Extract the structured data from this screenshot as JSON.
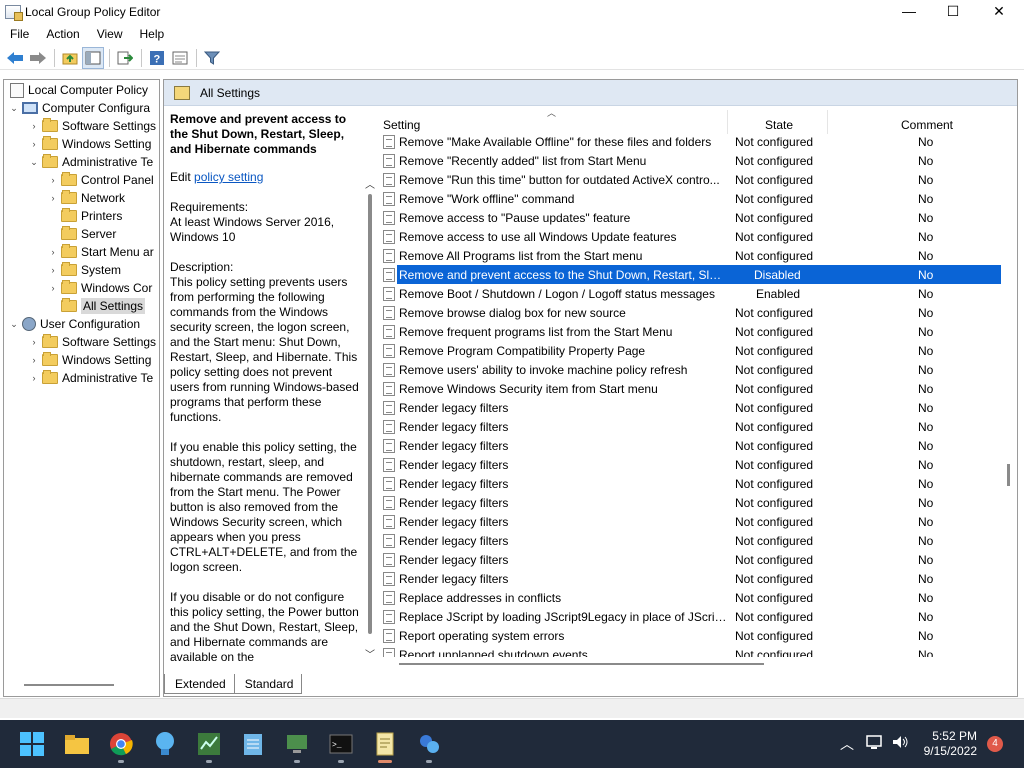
{
  "window": {
    "title": "Local Group Policy Editor",
    "minimize": "—",
    "maximize": "☐",
    "close": "✕"
  },
  "menu": [
    "File",
    "Action",
    "View",
    "Help"
  ],
  "tree": {
    "items": [
      {
        "label": "Local Computer Policy"
      },
      {
        "label": "Computer Configura"
      },
      {
        "label": "Software Settings"
      },
      {
        "label": "Windows Setting"
      },
      {
        "label": "Administrative Te"
      },
      {
        "label": "Control Panel"
      },
      {
        "label": "Network"
      },
      {
        "label": "Printers"
      },
      {
        "label": "Server"
      },
      {
        "label": "Start Menu ar"
      },
      {
        "label": "System"
      },
      {
        "label": "Windows Cor"
      },
      {
        "label": "All Settings"
      },
      {
        "label": "User Configuration"
      },
      {
        "label": "Software Settings"
      },
      {
        "label": "Windows Setting"
      },
      {
        "label": "Administrative Te"
      }
    ]
  },
  "panel": {
    "header": "All Settings"
  },
  "description": {
    "title": "Remove and prevent access to the Shut Down, Restart, Sleep, and Hibernate commands",
    "edit_prefix": "Edit ",
    "edit_link": "policy setting",
    "requirements": "Requirements:\nAt least Windows Server 2016, Windows 10",
    "description": "Description:\nThis policy setting prevents users from performing the following commands from the Windows security screen, the logon screen, and the Start menu: Shut Down, Restart, Sleep, and Hibernate. This policy setting does not prevent users from running Windows-based programs that perform these functions.",
    "enable_text": "If you enable this policy setting, the shutdown, restart, sleep, and hibernate commands are removed from the Start menu. The Power button is also removed from the Windows Security screen, which appears when you press CTRL+ALT+DELETE, and from the logon screen.",
    "disable_text": "If you disable or do not configure this policy setting, the Power button and the Shut Down, Restart, Sleep, and Hibernate commands are available on the"
  },
  "list": {
    "columns": {
      "setting": "Setting",
      "state": "State",
      "comment": "Comment"
    },
    "rows": [
      {
        "name": "Remove \"Make Available Offline\" for these files and folders",
        "state": "Not configured",
        "comment": "No"
      },
      {
        "name": "Remove \"Recently added\" list from Start Menu",
        "state": "Not configured",
        "comment": "No"
      },
      {
        "name": "Remove \"Run this time\" button for outdated ActiveX contro...",
        "state": "Not configured",
        "comment": "No"
      },
      {
        "name": "Remove \"Work offline\" command",
        "state": "Not configured",
        "comment": "No"
      },
      {
        "name": "Remove access to \"Pause updates\" feature",
        "state": "Not configured",
        "comment": "No"
      },
      {
        "name": "Remove access to use all Windows Update features",
        "state": "Not configured",
        "comment": "No"
      },
      {
        "name": "Remove All Programs list from the Start menu",
        "state": "Not configured",
        "comment": "No"
      },
      {
        "name": "Remove and prevent access to the Shut Down, Restart, Sleep...",
        "state": "Disabled",
        "comment": "No"
      },
      {
        "name": "Remove Boot / Shutdown / Logon / Logoff status messages",
        "state": "Enabled",
        "comment": "No"
      },
      {
        "name": "Remove browse dialog box for new source",
        "state": "Not configured",
        "comment": "No"
      },
      {
        "name": "Remove frequent programs list from the Start Menu",
        "state": "Not configured",
        "comment": "No"
      },
      {
        "name": "Remove Program Compatibility Property Page",
        "state": "Not configured",
        "comment": "No"
      },
      {
        "name": "Remove users' ability to invoke machine policy refresh",
        "state": "Not configured",
        "comment": "No"
      },
      {
        "name": "Remove Windows Security item from Start menu",
        "state": "Not configured",
        "comment": "No"
      },
      {
        "name": "Render legacy filters",
        "state": "Not configured",
        "comment": "No"
      },
      {
        "name": "Render legacy filters",
        "state": "Not configured",
        "comment": "No"
      },
      {
        "name": "Render legacy filters",
        "state": "Not configured",
        "comment": "No"
      },
      {
        "name": "Render legacy filters",
        "state": "Not configured",
        "comment": "No"
      },
      {
        "name": "Render legacy filters",
        "state": "Not configured",
        "comment": "No"
      },
      {
        "name": "Render legacy filters",
        "state": "Not configured",
        "comment": "No"
      },
      {
        "name": "Render legacy filters",
        "state": "Not configured",
        "comment": "No"
      },
      {
        "name": "Render legacy filters",
        "state": "Not configured",
        "comment": "No"
      },
      {
        "name": "Render legacy filters",
        "state": "Not configured",
        "comment": "No"
      },
      {
        "name": "Render legacy filters",
        "state": "Not configured",
        "comment": "No"
      },
      {
        "name": "Replace addresses in conflicts",
        "state": "Not configured",
        "comment": "No"
      },
      {
        "name": "Replace JScript by loading JScript9Legacy in place of JScript ...",
        "state": "Not configured",
        "comment": "No"
      },
      {
        "name": "Report operating system errors",
        "state": "Not configured",
        "comment": "No"
      },
      {
        "name": "Report unplanned shutdown events",
        "state": "Not configured",
        "comment": "No"
      }
    ]
  },
  "tabs": [
    "Extended",
    "Standard"
  ],
  "taskbar": {
    "time": "5:52 PM",
    "date": "9/15/2022",
    "notifications": "4"
  },
  "colors": {
    "selection": "#0a64d6",
    "header_bg": "#dfe8f3",
    "taskbar": "#202a3a"
  }
}
